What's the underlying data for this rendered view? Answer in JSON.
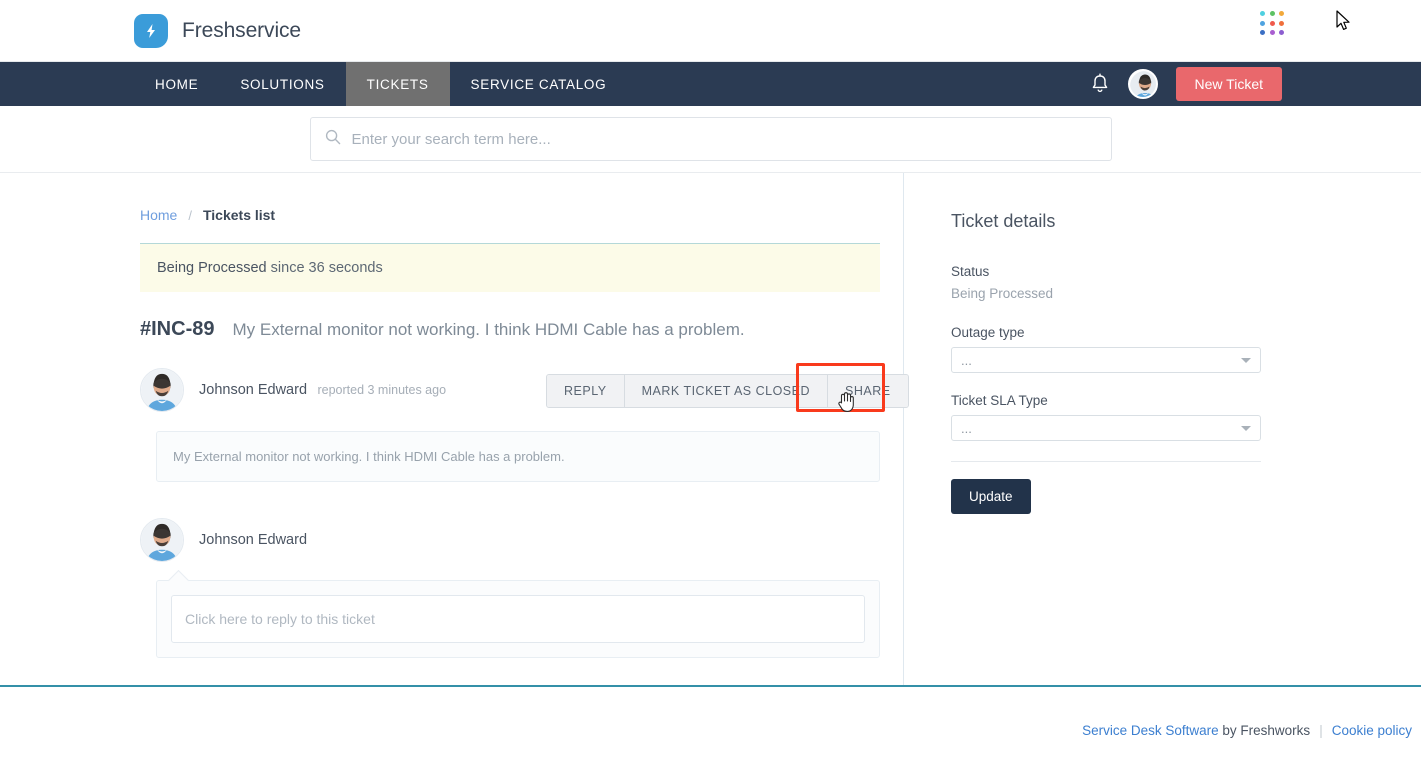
{
  "brand": {
    "name": "Freshservice",
    "logo_icon": "lightning-bolt-icon",
    "logo_color": "#3b9cd9",
    "apps_icon": "app-grid-icon"
  },
  "nav": {
    "items": [
      {
        "label": "HOME",
        "active": false
      },
      {
        "label": "SOLUTIONS",
        "active": false
      },
      {
        "label": "TICKETS",
        "active": true
      },
      {
        "label": "SERVICE CATALOG",
        "active": false
      }
    ],
    "bell_icon": "notification-bell-icon",
    "avatar": "user-avatar",
    "new_ticket_label": "New Ticket",
    "new_ticket_color": "#e9686c",
    "bar_color": "#2b3b53"
  },
  "search": {
    "placeholder": "Enter your search term here...",
    "value": "",
    "icon": "search-icon"
  },
  "breadcrumb": {
    "home": "Home",
    "separator": "/",
    "current": "Tickets list"
  },
  "actions": {
    "reply": "REPLY",
    "close": "MARK TICKET AS CLOSED",
    "share": "SHARE",
    "highlight_color": "#f93a1c"
  },
  "banner": {
    "status": "Being Processed",
    "since": "since 36 seconds"
  },
  "ticket": {
    "id": "#INC-89",
    "subject": "My External monitor not working. I think HDMI Cable has a problem.",
    "reporter": "Johnson Edward",
    "reported_meta": "reported 3 minutes ago",
    "description": "My External monitor not working. I think HDMI Cable has a problem."
  },
  "reply": {
    "author": "Johnson Edward",
    "placeholder": "Click here to reply to this ticket"
  },
  "details": {
    "title": "Ticket details",
    "status_label": "Status",
    "status_value": "Being Processed",
    "outage_label": "Outage type",
    "outage_value": "...",
    "sla_label": "Ticket SLA Type",
    "sla_value": "...",
    "update_label": "Update"
  },
  "footer": {
    "link_text": "Service Desk Software",
    "by_text": " by Freshworks",
    "separator": "|",
    "cookie_text": "Cookie policy"
  }
}
